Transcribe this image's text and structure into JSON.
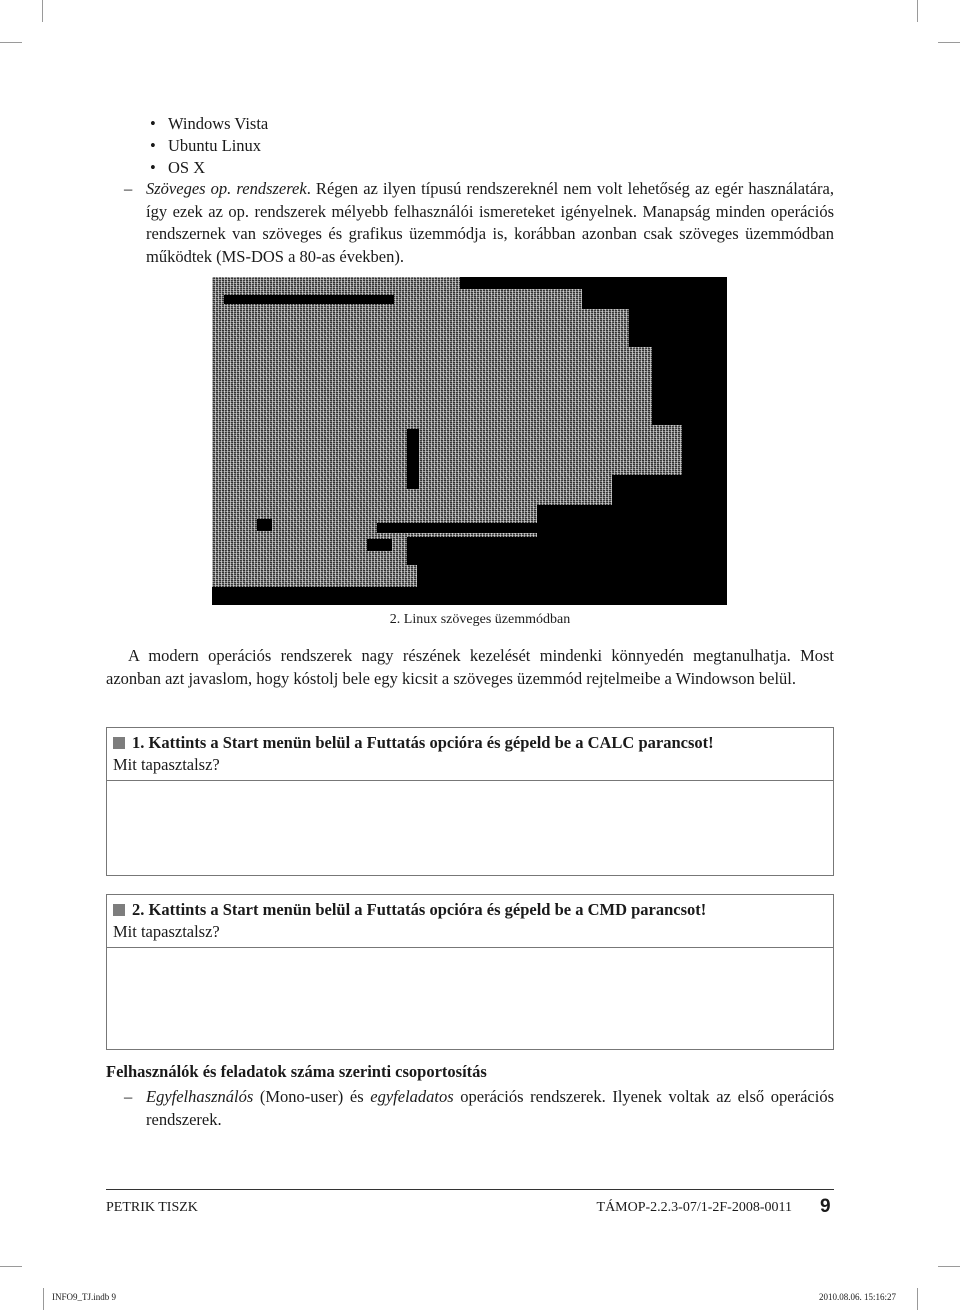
{
  "os_list": [
    "Windows Vista",
    "Ubuntu Linux",
    "OS X"
  ],
  "bullet_glyph": "•",
  "dash_glyph": "–",
  "text_mode_item": {
    "italic_term": "Szöveges op. rendszerek",
    "text": ". Régen az ilyen típusú rendszereknél nem volt lehetőség az egér használatára, így ezek az op. rendszerek mélyebb felhasználói ismereteket igényelnek. Manapság minden operációs rendszernek van szöveges és grafikus üzemmódja is, korábban azonban csak szöveges üzemmódban működtek (MS-DOS a 80-as években)."
  },
  "figure": {
    "caption": "2. Linux szöveges üzemmódban",
    "background": "#000000"
  },
  "intro_paragraph": "A modern operációs rendszerek nagy részének kezelését mindenki könnyedén megtanulhatja. Most azonban azt javaslom, hogy kóstolj bele egy kicsit a szöveges üzemmód rejtelmeibe a Windowson belül.",
  "tasks": [
    {
      "title": "1. Kattints a Start menün belül a Futtatás opcióra és gépeld be a CALC parancsot!",
      "question": "Mit tapasztalsz?",
      "answer": ""
    },
    {
      "title": "2. Kattints a Start menün belül a Futtatás opcióra és gépeld be a CMD parancsot!",
      "question": "Mit tapasztalsz?",
      "answer": ""
    }
  ],
  "task_marker_color": "#7d7d7d",
  "section": {
    "heading": "Felhasználók és feladatok száma szerinti csoportosítás",
    "item": {
      "italic1": "Egyfelhasználós",
      "text1": " (Mono-user) és ",
      "italic2": "egyfeladatos",
      "text2": " operációs rendszerek. Ilyenek voltak az első operációs rendszerek."
    }
  },
  "footer": {
    "left": "PETRIK TISZK",
    "right": "TÁMOP-2.2.3-07/1-2F-2008-0011",
    "page_number": "9"
  },
  "slug": {
    "file": "INFO9_TJ.indb   9",
    "timestamp": "2010.08.06.   15:16:27"
  }
}
